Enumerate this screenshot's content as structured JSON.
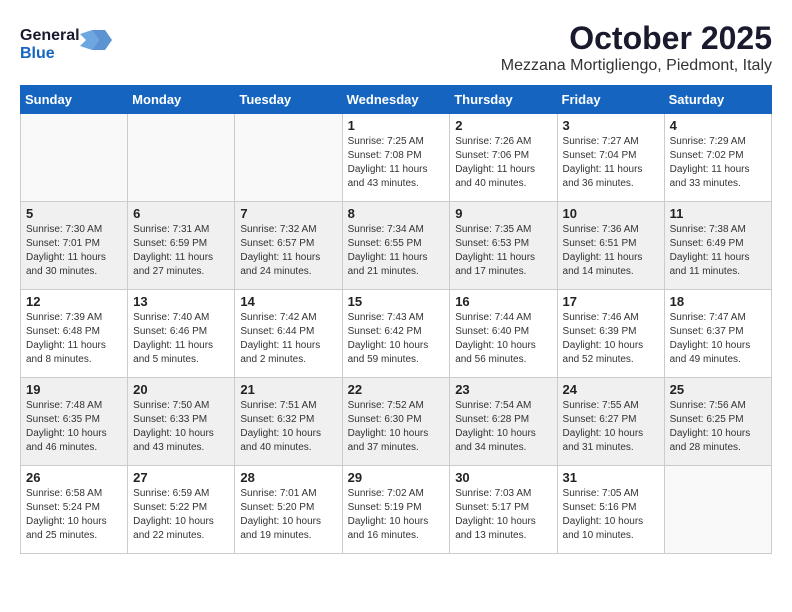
{
  "header": {
    "logo_general": "General",
    "logo_blue": "Blue",
    "month": "October 2025",
    "location": "Mezzana Mortigliengo, Piedmont, Italy"
  },
  "days_of_week": [
    "Sunday",
    "Monday",
    "Tuesday",
    "Wednesday",
    "Thursday",
    "Friday",
    "Saturday"
  ],
  "weeks": [
    [
      {
        "day": "",
        "sunrise": "",
        "sunset": "",
        "daylight": "",
        "empty": true
      },
      {
        "day": "",
        "sunrise": "",
        "sunset": "",
        "daylight": "",
        "empty": true
      },
      {
        "day": "",
        "sunrise": "",
        "sunset": "",
        "daylight": "",
        "empty": true
      },
      {
        "day": "1",
        "sunrise": "Sunrise: 7:25 AM",
        "sunset": "Sunset: 7:08 PM",
        "daylight": "Daylight: 11 hours and 43 minutes."
      },
      {
        "day": "2",
        "sunrise": "Sunrise: 7:26 AM",
        "sunset": "Sunset: 7:06 PM",
        "daylight": "Daylight: 11 hours and 40 minutes."
      },
      {
        "day": "3",
        "sunrise": "Sunrise: 7:27 AM",
        "sunset": "Sunset: 7:04 PM",
        "daylight": "Daylight: 11 hours and 36 minutes."
      },
      {
        "day": "4",
        "sunrise": "Sunrise: 7:29 AM",
        "sunset": "Sunset: 7:02 PM",
        "daylight": "Daylight: 11 hours and 33 minutes."
      }
    ],
    [
      {
        "day": "5",
        "sunrise": "Sunrise: 7:30 AM",
        "sunset": "Sunset: 7:01 PM",
        "daylight": "Daylight: 11 hours and 30 minutes."
      },
      {
        "day": "6",
        "sunrise": "Sunrise: 7:31 AM",
        "sunset": "Sunset: 6:59 PM",
        "daylight": "Daylight: 11 hours and 27 minutes."
      },
      {
        "day": "7",
        "sunrise": "Sunrise: 7:32 AM",
        "sunset": "Sunset: 6:57 PM",
        "daylight": "Daylight: 11 hours and 24 minutes."
      },
      {
        "day": "8",
        "sunrise": "Sunrise: 7:34 AM",
        "sunset": "Sunset: 6:55 PM",
        "daylight": "Daylight: 11 hours and 21 minutes."
      },
      {
        "day": "9",
        "sunrise": "Sunrise: 7:35 AM",
        "sunset": "Sunset: 6:53 PM",
        "daylight": "Daylight: 11 hours and 17 minutes."
      },
      {
        "day": "10",
        "sunrise": "Sunrise: 7:36 AM",
        "sunset": "Sunset: 6:51 PM",
        "daylight": "Daylight: 11 hours and 14 minutes."
      },
      {
        "day": "11",
        "sunrise": "Sunrise: 7:38 AM",
        "sunset": "Sunset: 6:49 PM",
        "daylight": "Daylight: 11 hours and 11 minutes."
      }
    ],
    [
      {
        "day": "12",
        "sunrise": "Sunrise: 7:39 AM",
        "sunset": "Sunset: 6:48 PM",
        "daylight": "Daylight: 11 hours and 8 minutes."
      },
      {
        "day": "13",
        "sunrise": "Sunrise: 7:40 AM",
        "sunset": "Sunset: 6:46 PM",
        "daylight": "Daylight: 11 hours and 5 minutes."
      },
      {
        "day": "14",
        "sunrise": "Sunrise: 7:42 AM",
        "sunset": "Sunset: 6:44 PM",
        "daylight": "Daylight: 11 hours and 2 minutes."
      },
      {
        "day": "15",
        "sunrise": "Sunrise: 7:43 AM",
        "sunset": "Sunset: 6:42 PM",
        "daylight": "Daylight: 10 hours and 59 minutes."
      },
      {
        "day": "16",
        "sunrise": "Sunrise: 7:44 AM",
        "sunset": "Sunset: 6:40 PM",
        "daylight": "Daylight: 10 hours and 56 minutes."
      },
      {
        "day": "17",
        "sunrise": "Sunrise: 7:46 AM",
        "sunset": "Sunset: 6:39 PM",
        "daylight": "Daylight: 10 hours and 52 minutes."
      },
      {
        "day": "18",
        "sunrise": "Sunrise: 7:47 AM",
        "sunset": "Sunset: 6:37 PM",
        "daylight": "Daylight: 10 hours and 49 minutes."
      }
    ],
    [
      {
        "day": "19",
        "sunrise": "Sunrise: 7:48 AM",
        "sunset": "Sunset: 6:35 PM",
        "daylight": "Daylight: 10 hours and 46 minutes."
      },
      {
        "day": "20",
        "sunrise": "Sunrise: 7:50 AM",
        "sunset": "Sunset: 6:33 PM",
        "daylight": "Daylight: 10 hours and 43 minutes."
      },
      {
        "day": "21",
        "sunrise": "Sunrise: 7:51 AM",
        "sunset": "Sunset: 6:32 PM",
        "daylight": "Daylight: 10 hours and 40 minutes."
      },
      {
        "day": "22",
        "sunrise": "Sunrise: 7:52 AM",
        "sunset": "Sunset: 6:30 PM",
        "daylight": "Daylight: 10 hours and 37 minutes."
      },
      {
        "day": "23",
        "sunrise": "Sunrise: 7:54 AM",
        "sunset": "Sunset: 6:28 PM",
        "daylight": "Daylight: 10 hours and 34 minutes."
      },
      {
        "day": "24",
        "sunrise": "Sunrise: 7:55 AM",
        "sunset": "Sunset: 6:27 PM",
        "daylight": "Daylight: 10 hours and 31 minutes."
      },
      {
        "day": "25",
        "sunrise": "Sunrise: 7:56 AM",
        "sunset": "Sunset: 6:25 PM",
        "daylight": "Daylight: 10 hours and 28 minutes."
      }
    ],
    [
      {
        "day": "26",
        "sunrise": "Sunrise: 6:58 AM",
        "sunset": "Sunset: 5:24 PM",
        "daylight": "Daylight: 10 hours and 25 minutes."
      },
      {
        "day": "27",
        "sunrise": "Sunrise: 6:59 AM",
        "sunset": "Sunset: 5:22 PM",
        "daylight": "Daylight: 10 hours and 22 minutes."
      },
      {
        "day": "28",
        "sunrise": "Sunrise: 7:01 AM",
        "sunset": "Sunset: 5:20 PM",
        "daylight": "Daylight: 10 hours and 19 minutes."
      },
      {
        "day": "29",
        "sunrise": "Sunrise: 7:02 AM",
        "sunset": "Sunset: 5:19 PM",
        "daylight": "Daylight: 10 hours and 16 minutes."
      },
      {
        "day": "30",
        "sunrise": "Sunrise: 7:03 AM",
        "sunset": "Sunset: 5:17 PM",
        "daylight": "Daylight: 10 hours and 13 minutes."
      },
      {
        "day": "31",
        "sunrise": "Sunrise: 7:05 AM",
        "sunset": "Sunset: 5:16 PM",
        "daylight": "Daylight: 10 hours and 10 minutes."
      },
      {
        "day": "",
        "sunrise": "",
        "sunset": "",
        "daylight": "",
        "empty": true
      }
    ]
  ]
}
